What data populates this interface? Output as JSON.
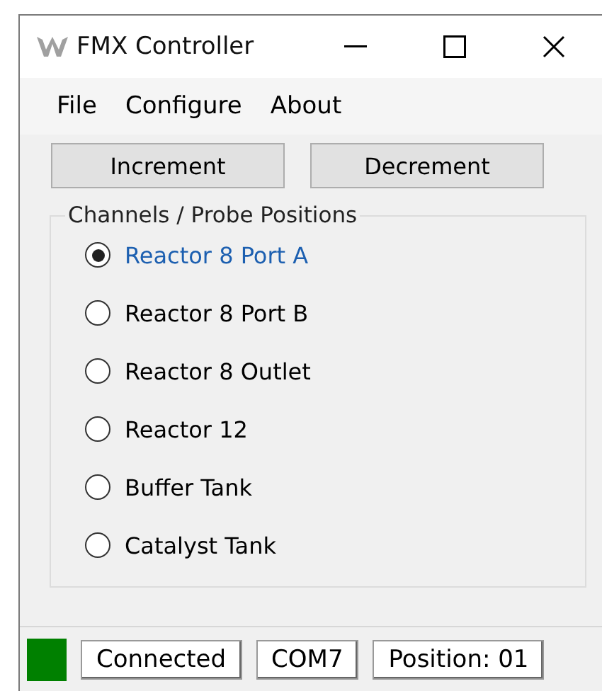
{
  "window": {
    "title": "FMX Controller"
  },
  "menu": [
    "File",
    "Configure",
    "About"
  ],
  "buttons": [
    "Increment",
    "Decrement"
  ],
  "group": {
    "title": "Channels / Probe Positions",
    "channels": [
      {
        "label": "Reactor 8 Port A",
        "selected": true
      },
      {
        "label": "Reactor 8 Port B",
        "selected": false
      },
      {
        "label": "Reactor 8 Outlet",
        "selected": false
      },
      {
        "label": "Reactor 12",
        "selected": false
      },
      {
        "label": "Buffer Tank",
        "selected": false
      },
      {
        "label": "Catalyst Tank",
        "selected": false
      }
    ]
  },
  "status_bar": {
    "indicator": {
      "color": "#008000"
    },
    "panels": [
      "Connected",
      "COM7",
      "Position: 01"
    ]
  }
}
